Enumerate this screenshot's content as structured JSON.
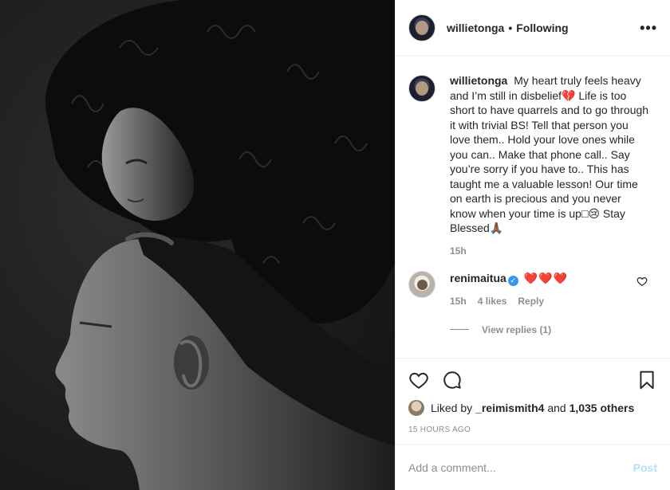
{
  "post": {
    "author": "willietonga",
    "separator": "•",
    "follow_status": "Following",
    "more_label": "•••"
  },
  "caption": {
    "username": "willietonga",
    "text": "My heart truly feels heavy and I’m still in disbelief💔 Life is too short to have quarrels and to go through it with trivial BS! Tell that person you love them.. Hold your love ones while you can.. Make that phone call.. Say you’re sorry if you have to.. This has taught me a valuable lesson! Our time on earth is precious and you never know when your time is up□😢 Stay Blessed🙏🏾",
    "age": "15h"
  },
  "comment": {
    "username": "renimaitua",
    "verified_mark": "✓",
    "text": "❤️❤️❤️",
    "age": "15h",
    "likes": "4 likes",
    "reply_label": "Reply",
    "view_replies": "View replies (1)"
  },
  "likes": {
    "prefix": "Liked by",
    "first_liker": "_reimismith4",
    "joiner": "and",
    "others": "1,035 others"
  },
  "timestamp": "15 HOURS AGO",
  "add_comment": {
    "placeholder": "Add a comment...",
    "post_label": "Post"
  },
  "colors": {
    "accent": "#3897f0",
    "heart": "#ed4956",
    "muted": "#8e8e8e",
    "post_disabled": "#b2dffc"
  },
  "icons": {
    "like": "heart-outline-icon",
    "comment": "comment-bubble-icon",
    "save": "bookmark-icon",
    "more": "more-options-icon"
  }
}
